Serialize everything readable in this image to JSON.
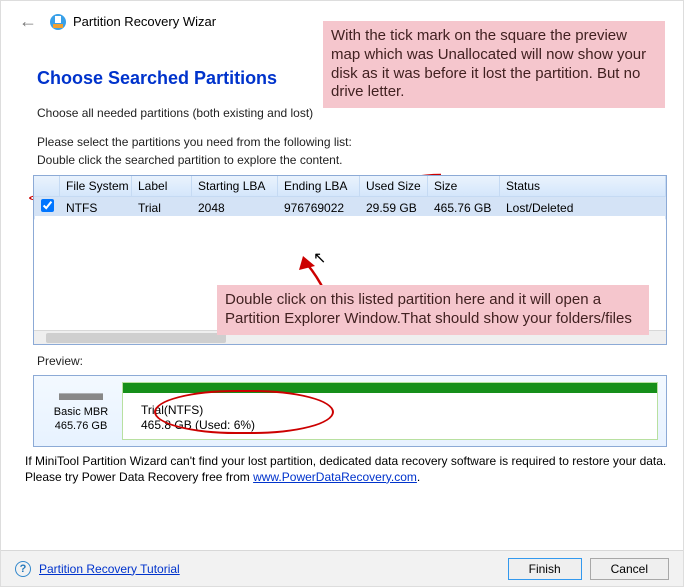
{
  "header": {
    "app_title": "Partition Recovery Wizar"
  },
  "main": {
    "title": "Choose Searched Partitions",
    "line1": "Choose all needed partitions (both existing and lost)",
    "line2": "Please select the partitions you need from the following list:",
    "line3": "Double click the searched partition to explore the content.",
    "columns": {
      "filesystem": "File System",
      "label": "Label",
      "starting_lba": "Starting LBA",
      "ending_lba": "Ending LBA",
      "used_size": "Used Size",
      "size": "Size",
      "status": "Status"
    },
    "row": {
      "filesystem": "NTFS",
      "label": "Trial",
      "starting_lba": "2048",
      "ending_lba": "976769022",
      "used_size": "29.59 GB",
      "size": "465.76 GB",
      "status": "Lost/Deleted"
    },
    "preview_label": "Preview:",
    "disk": {
      "type": "Basic MBR",
      "size": "465.76 GB"
    },
    "partition_bar": {
      "title": "Trial(NTFS)",
      "detail": "465.8 GB (Used: 6%)"
    },
    "note": "If MiniTool Partition Wizard can't find your lost partition, dedicated data recovery software is required to restore your data. Please try Power Data Recovery free from ",
    "note_link_text": "www.PowerDataRecovery.com",
    "note_suffix": "."
  },
  "footer": {
    "help_link": "Partition Recovery Tutorial",
    "finish": "Finish",
    "cancel": "Cancel"
  },
  "annotations": {
    "top": "With the tick mark on the square the preview map which was Unallocated will now show your disk as it was before it lost the partition. But no drive letter.",
    "mid": "Double click on this listed partition here and it will open a Partition Explorer Window.That should show your folders/files"
  }
}
